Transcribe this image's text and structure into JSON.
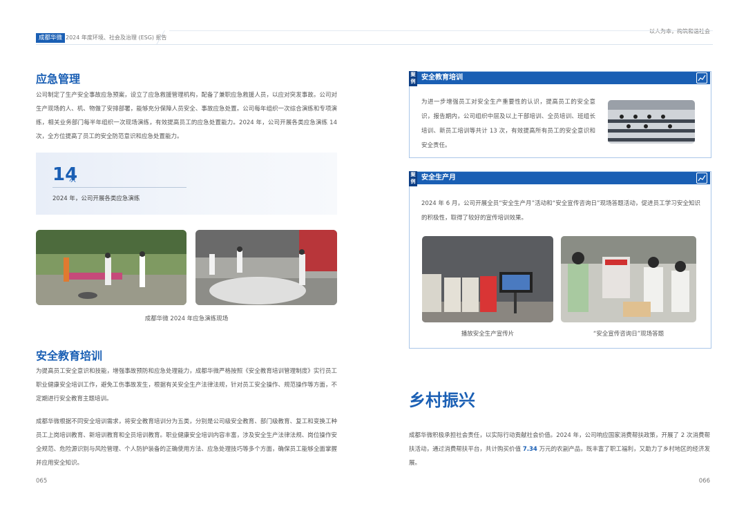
{
  "header": {
    "brand": "成都华微",
    "report_title": "2024 年度环境、社会及治理 (ESG) 报告",
    "slogan": "以人为本，构筑和谐社会"
  },
  "left": {
    "emergency": {
      "title": "应急管理",
      "body": "公司制定了生产安全事故应急预案，设立了应急救援管理机构，配备了兼职应急救援人员，以应对突发事故。公司对生产现场的人、机、物做了安排部署，能够充分保障人员安全、事故应急处置。公司每年组织一次综合演练和专项演练，相关业务部门每半年组织一次现场演练，有效提高员工的应急处置能力。2024 年，公司开展各类应急演练 14 次，全方位提高了员工的安全防范意识和应急处置能力。"
    },
    "stat": {
      "number": "14",
      "unit": "次",
      "desc": "2024 年，公司开展各类应急演练"
    },
    "drill_caption": "成都华微 2024 年应急演练现场",
    "training": {
      "title": "安全教育培训",
      "para1": "为提高员工安全意识和技能，增强事故预防和应急处理能力，成都华微严格按照《安全教育培训管理制度》实行员工职业健康安全培训工作，避免工伤事故发生，根据有关安全生产法律法规，针对员工安全操作、规范操作等方面，不定期进行安全教育主题培训。",
      "para2": "成都华微根据不同安全培训需求，将安全教育培训分为五类，分别是公司级安全教育、部门级教育、复工和变换工种员工上岗培训教育、新培训教育和全员培训教育。职业健康安全培训内容丰富，涉及安全生产法律法规、岗位操作安全规范、危险源识别与风险管理、个人防护装备的正确使用方法、应急处理技巧等多个方面，确保员工能够全面掌握并应用安全知识。"
    },
    "page_number": "065"
  },
  "right": {
    "case1": {
      "badge": "案例",
      "title": "安全教育培训",
      "body": "为进一步增强员工对安全生产重要性的认识，提高员工的安全意识，报告期内，公司组织中层及以上干部培训、全员培训、班组长培训、新员工培训等共计 13 次，有效提高所有员工的安全意识和安全责任。"
    },
    "case2": {
      "badge": "案例",
      "title": "安全生产月",
      "body": "2024 年 6 月，公司开展全员“安全生产月”活动和“安全宣传咨询日”现场答题活动，促进员工学习安全知识的积极性，取得了较好的宣传培训效果。",
      "caption_left": "播放安全生产宣传片",
      "caption_right": "“安全宣传咨询日”现场答题"
    },
    "rural": {
      "title": "乡村振兴",
      "body_pre": "成都华微积极承担社会责任，以实际行动贡献社会价值。2024 年，公司响应国家消费帮扶政策，开展了 2 次消费帮扶活动，通过消费帮扶平台，共计购买价值 ",
      "highlight": "7.34",
      "body_post": " 万元的农副产品，既丰富了职工福利，又助力了乡村地区的经济发展。"
    },
    "page_number": "066"
  },
  "colors": {
    "accent": "#1a5fb4",
    "badge": "#0e3f85",
    "border": "#a9c6e8"
  }
}
